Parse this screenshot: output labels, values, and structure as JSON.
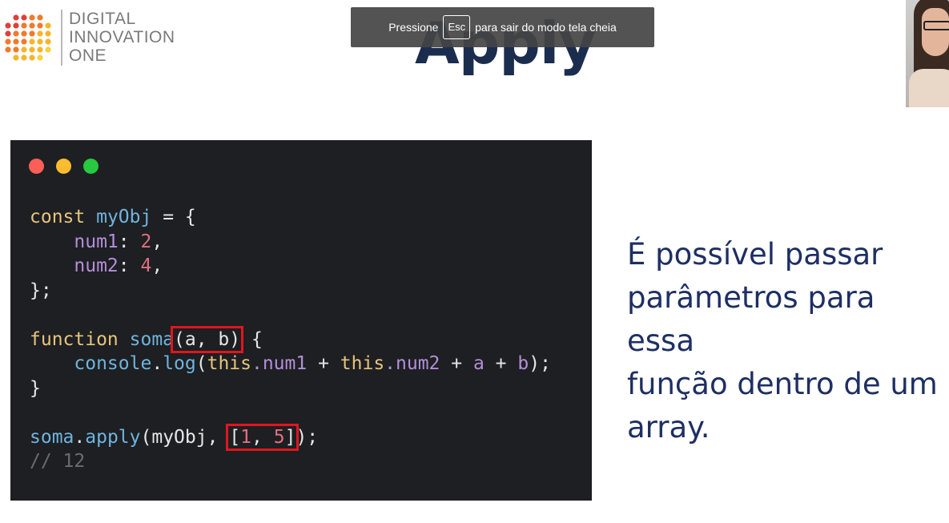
{
  "logo": {
    "lines": [
      "DIGITAL",
      "INNOVATION",
      "ONE"
    ],
    "dot_colors": [
      "#e0403a",
      "#f07a2a",
      "#f5b52a",
      "#f7d23a"
    ]
  },
  "slide": {
    "title": "Apply"
  },
  "toast": {
    "before": "Pressione",
    "key": "Esc",
    "after": "para sair do modo tela cheia"
  },
  "code": {
    "line1": {
      "kw": "const",
      "name": "myObj",
      "rest": " = {"
    },
    "line2": {
      "prop": "num1",
      "sep": ": ",
      "val": "2",
      "end": ","
    },
    "line3": {
      "prop": "num2",
      "sep": ": ",
      "val": "4",
      "end": ","
    },
    "line4": "};",
    "line6": {
      "kw": "function",
      "name": "soma",
      "params": "(a, b)",
      "rest": " {"
    },
    "line7": {
      "obj": "console",
      "dot": ".",
      "method": "log",
      "open": "(",
      "this1": "this",
      "prop1": ".num1",
      "plus1": " + ",
      "this2": "this",
      "prop2": ".num2",
      "plus2": " + ",
      "a": "a",
      "plus3": " + ",
      "b": "b",
      "close": ");"
    },
    "line8": "}",
    "line10": {
      "obj": "soma",
      "dot": ".",
      "method": "apply",
      "open": "(",
      "arg": "myObj",
      "comma": ", ",
      "arr_open": "[",
      "n1": "1",
      "arr_comma": ", ",
      "n2": "5",
      "arr_close": "]",
      "close": ");"
    },
    "line11": "// 12"
  },
  "description": [
    "É possível passar",
    "parâmetros para essa",
    "função dentro de um",
    "array."
  ]
}
